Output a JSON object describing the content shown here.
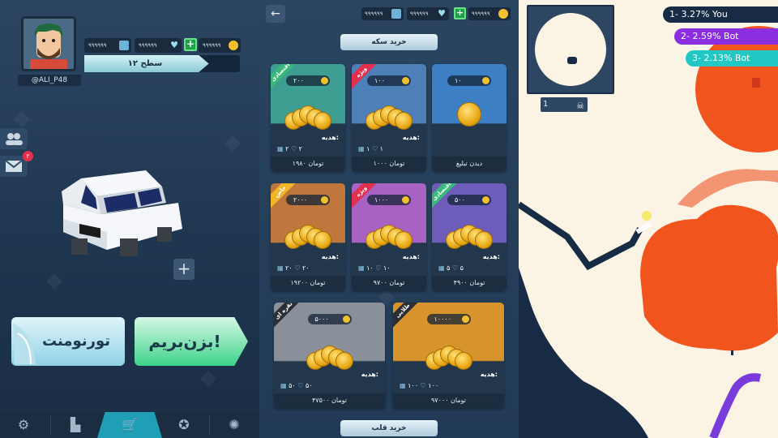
{
  "profile": {
    "username": "@ALI_P48",
    "level_label": "سطح ۱۲",
    "level_progress": 0.8
  },
  "resources": {
    "gems": "۹۹۹۹۹۹",
    "hearts": "۹۹۹۹۹۹",
    "coins": "۹۹۹۹۹۹",
    "add": "+"
  },
  "sidebar": {
    "messages_badge": "۲"
  },
  "car_add": "+",
  "buttons": {
    "play": "بزن‌بریم!",
    "tournament": "تورنومنت"
  },
  "tabs": [
    {
      "icon": "gear-icon",
      "glyph": "⚙"
    },
    {
      "icon": "leaderboard-icon",
      "glyph": "▙"
    },
    {
      "icon": "shop-cart-icon",
      "glyph": "🛒"
    },
    {
      "icon": "badge-icon",
      "glyph": "✪"
    },
    {
      "icon": "fan-icon",
      "glyph": "✺"
    }
  ],
  "shop": {
    "back": "←",
    "title": "خرید سکه",
    "hearts_section": "خرید قلب",
    "gift_label": "هدیه:",
    "row1": [
      {
        "amount": "۲۰۰",
        "price": "۱۹۸۰ تومان",
        "ribbon": "اقتصادی",
        "hearts": "۲",
        "gems": "۲",
        "color": "#3f9e92"
      },
      {
        "amount": "۱۰۰",
        "price": "۱۰۰۰ تومان",
        "ribbon": "ویژه",
        "hearts": "۱",
        "gems": "۱",
        "color": "#4d7fb8"
      },
      {
        "amount": "۱۰",
        "price": "دیدن تبلیغ",
        "ribbon": "",
        "hearts": "",
        "gems": "",
        "color": "#3c7fc4"
      }
    ],
    "row2": [
      {
        "amount": "۲۰۰۰",
        "price": "۱۹۲۰۰ تومان",
        "ribbon": "خاص",
        "hearts": "۲۰",
        "gems": "۲۰",
        "color": "#c0773d"
      },
      {
        "amount": "۱۰۰۰",
        "price": "۹۷۰۰ تومان",
        "ribbon": "ویژه",
        "hearts": "۱۰",
        "gems": "۱۰",
        "color": "#a862c4"
      },
      {
        "amount": "۵۰۰",
        "price": "۴۹۰۰ تومان",
        "ribbon": "اقتصادی",
        "hearts": "۵",
        "gems": "۵",
        "color": "#6e5cba"
      }
    ],
    "row3": [
      {
        "amount": "۵۰۰۰",
        "price": "۴۷۵۰۰ تومان",
        "ribbon": "نقره ای",
        "hearts": "۵۰",
        "gems": "۵۰",
        "color": "#8a9099"
      },
      {
        "amount": "۱۰۰۰۰",
        "price": "۹۷۰۰۰ تومان",
        "ribbon": "طلایی",
        "hearts": "۱۰۰",
        "gems": "۱۰۰",
        "color": "#d8942c"
      }
    ]
  },
  "game": {
    "players_count": "1",
    "leaderboard": [
      {
        "text": "1- 3.27% You",
        "color": "#172b45"
      },
      {
        "text": "2- 2.59% Bot",
        "color": "#8a2ee0"
      },
      {
        "text": "3- 2.13% Bot",
        "color": "#22c9c4"
      }
    ]
  },
  "colors": {
    "accent": "#1e9fb6",
    "play_green": "#3ed38a",
    "orange": "#f2541d",
    "navy": "#172b45",
    "purple": "#8a2ee0",
    "teal": "#22c9c4"
  }
}
